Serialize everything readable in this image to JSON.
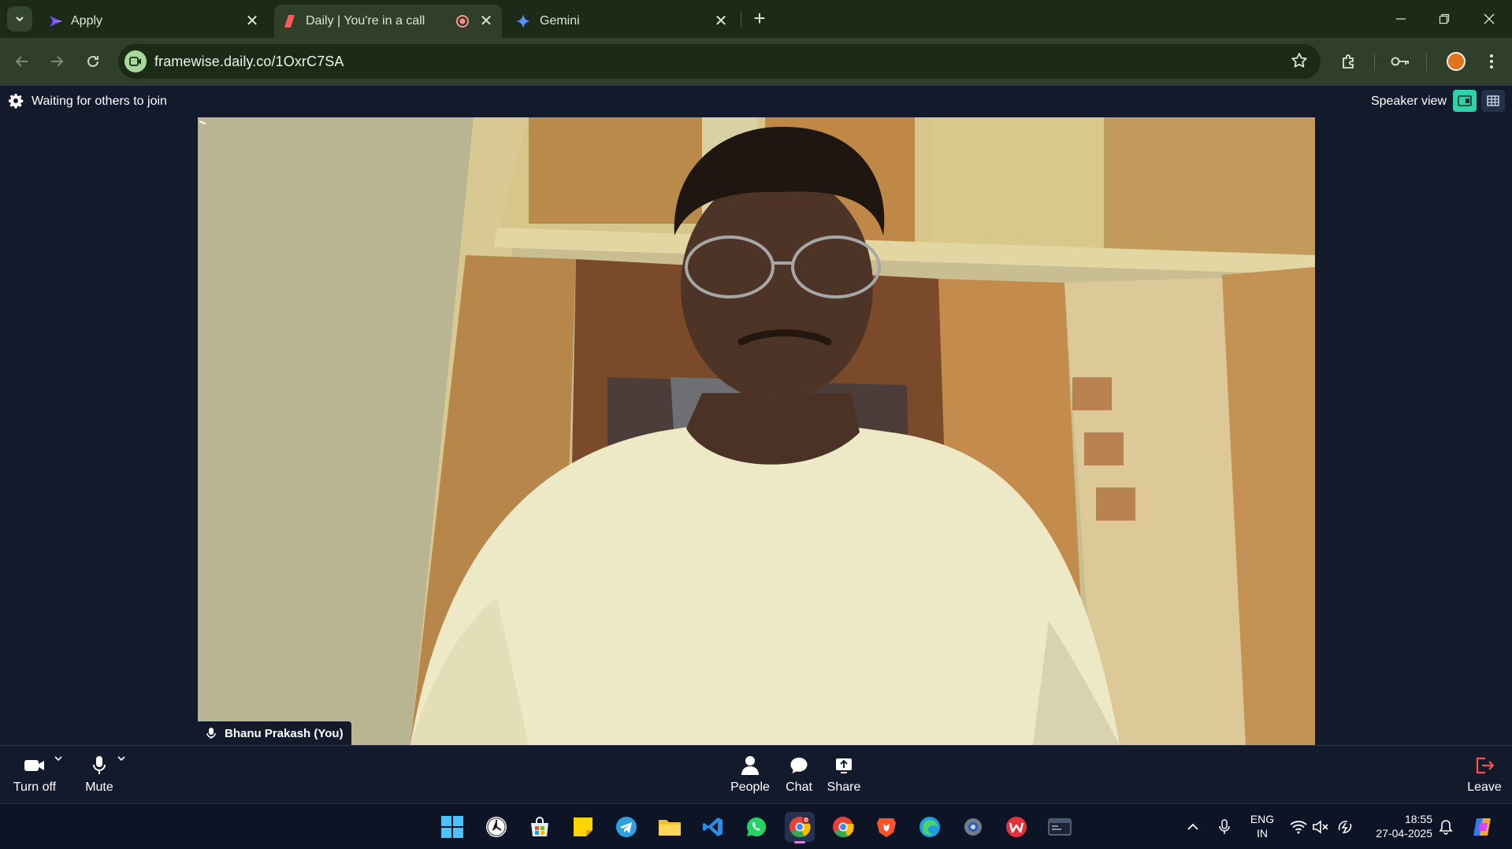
{
  "browser": {
    "tabs": [
      {
        "title": "Apply",
        "icon": "apply-tab-icon",
        "close": "✕"
      },
      {
        "title": "Daily | You're in a call",
        "icon": "daily-tab-icon",
        "close": "✕",
        "recording": true
      },
      {
        "title": "Gemini",
        "icon": "gemini-sparkle-icon",
        "close": "✕"
      }
    ],
    "new_tab": "+",
    "url": "framewise.daily.co/1OxrC7SA",
    "colors": {
      "chrome_bg": "#1c2b18",
      "toolbar_bg": "#2f3f29",
      "site_icon": "#a8d99a"
    }
  },
  "call": {
    "status": "Waiting for others to join",
    "view_label": "Speaker view",
    "participant_name": "Bhanu Prakash (You)",
    "accent": "#2ad4a8",
    "controls": {
      "camera": "Turn off",
      "mic": "Mute",
      "people": "People",
      "chat": "Chat",
      "share": "Share",
      "leave": "Leave"
    }
  },
  "taskbar": {
    "apps": [
      "start",
      "clock-app",
      "microsoft-store",
      "sticky-notes",
      "telegram",
      "file-explorer",
      "vs-code",
      "whatsapp",
      "chrome-active",
      "chrome",
      "brave",
      "edge",
      "settings",
      "wps-office",
      "terminal"
    ],
    "lang_line1": "ENG",
    "lang_line2": "IN",
    "time": "18:55",
    "date": "27-04-2025"
  }
}
